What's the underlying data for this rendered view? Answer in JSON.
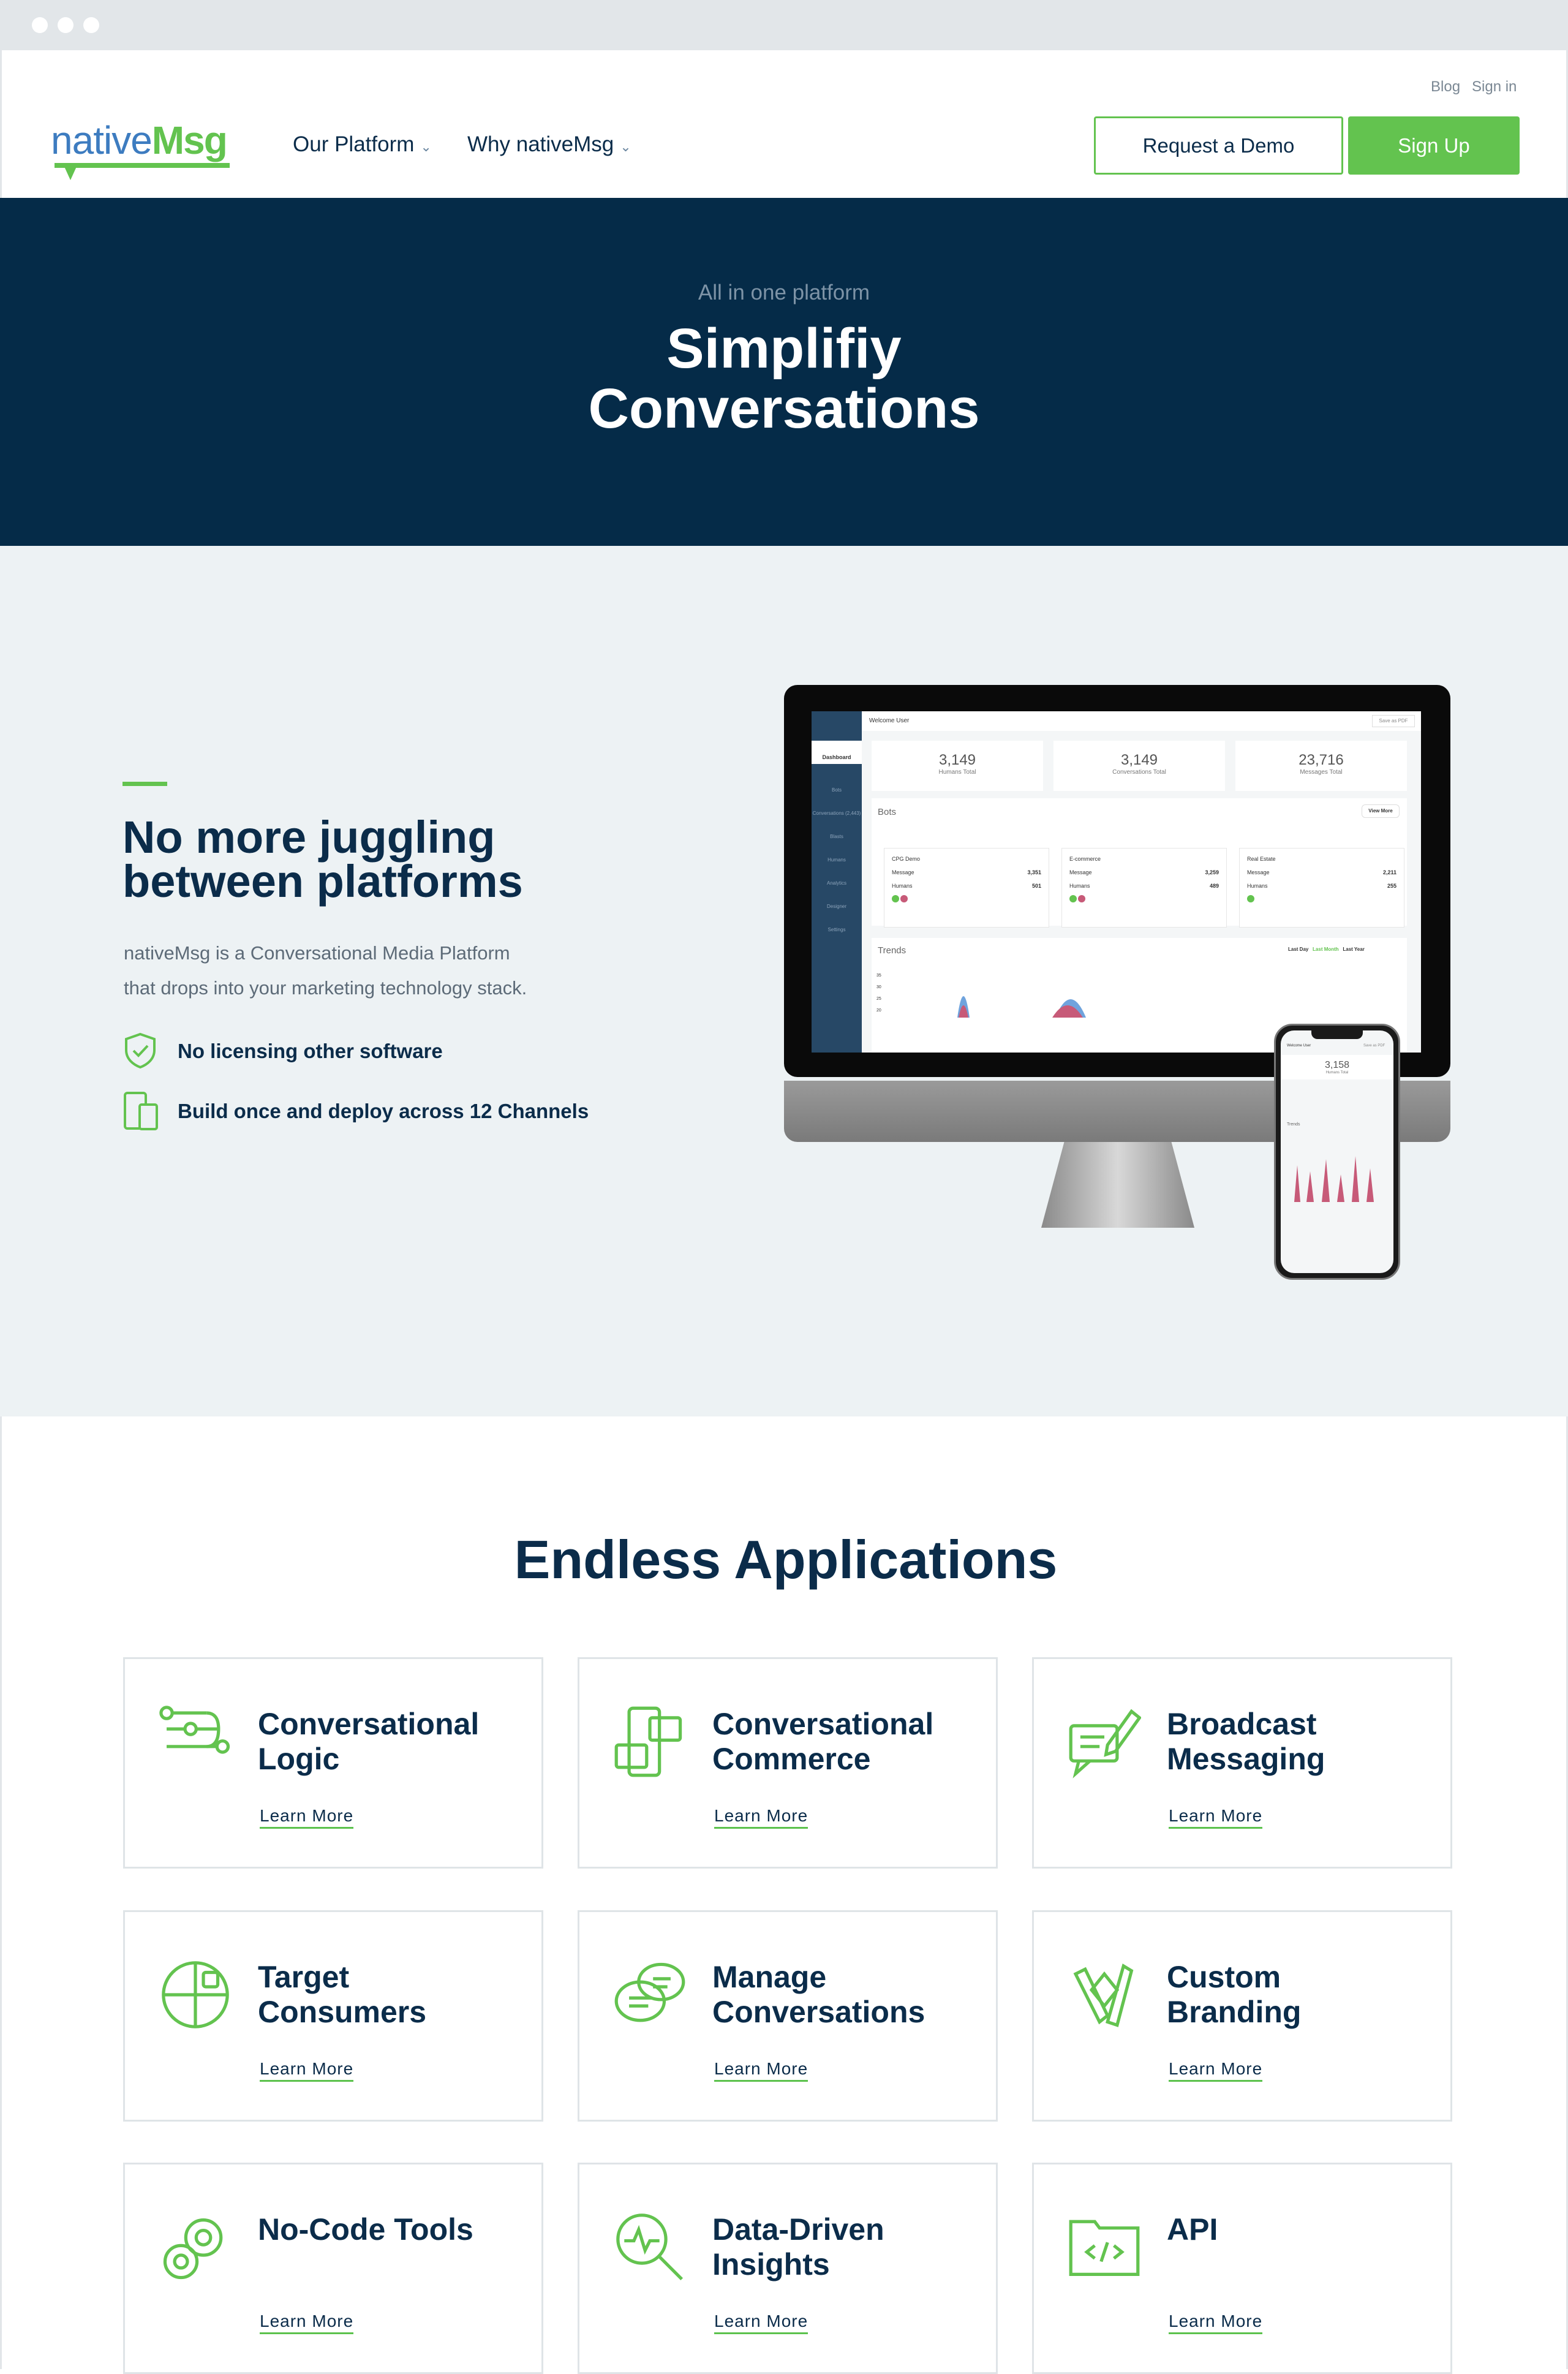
{
  "header": {
    "top_links": [
      "Blog",
      "Sign in"
    ],
    "logo": {
      "part1": "native",
      "part2": "Msg"
    },
    "nav": [
      {
        "label": "Our Platform"
      },
      {
        "label": "Why nativeMsg"
      }
    ],
    "request_demo": "Request a Demo",
    "sign_up": "Sign Up"
  },
  "hero": {
    "eyebrow": "All in one platform",
    "title_line1": "Simplifiy",
    "title_line2": "Conversations"
  },
  "intro": {
    "heading_line1": "No more juggling",
    "heading_line2": "between platforms",
    "paragraph_line1": "nativeMsg is a Conversational Media Platform",
    "paragraph_line2": "that drops into your marketing technology stack.",
    "features": [
      {
        "icon": "shield-check-icon",
        "label": "No licensing other software"
      },
      {
        "icon": "devices-icon",
        "label": "Build once and deploy across 12 Channels"
      }
    ]
  },
  "dashboard": {
    "welcome": "Welcome User",
    "save_pdf": "Save as PDF",
    "sidebar": [
      "Dashboard",
      "Bots",
      "Conversations (2,443)",
      "Blasts",
      "Humans",
      "Analytics",
      "Designer",
      "Settings"
    ],
    "stats": [
      {
        "value": "3,149",
        "label": "Humans Total"
      },
      {
        "value": "3,149",
        "label": "Conversations Total"
      },
      {
        "value": "23,716",
        "label": "Messages Total"
      }
    ],
    "bots_title": "Bots",
    "view_more": "View More",
    "bots": [
      {
        "name": "CPG Demo",
        "message": "3,351",
        "humans": "501"
      },
      {
        "name": "E-commerce",
        "message": "3,259",
        "humans": "489"
      },
      {
        "name": "Real Estate",
        "message": "2,211",
        "humans": "255"
      }
    ],
    "row_labels": {
      "message": "Message",
      "humans": "Humans"
    },
    "trends": "Trends",
    "ranges": [
      "Last Day",
      "Last Month",
      "Last Year"
    ],
    "y_ticks": [
      "35",
      "30",
      "25",
      "20"
    ],
    "phone": {
      "welcome": "Welcome User",
      "save_pdf": "Save as PDF",
      "value": "3,158",
      "label": "Humans Total",
      "trends": "Trends"
    }
  },
  "applications": {
    "title": "Endless Applications",
    "learn_more": "Learn More",
    "cards": [
      {
        "title": "Conversational Logic",
        "icon": "logic-flow-icon"
      },
      {
        "title": "Conversational Commerce",
        "icon": "phone-chat-icon"
      },
      {
        "title": "Broadcast Messaging",
        "icon": "broadcast-pen-icon"
      },
      {
        "title": "Target Consumers",
        "icon": "target-pie-icon"
      },
      {
        "title": "Manage Conversations",
        "icon": "chat-bubbles-icon"
      },
      {
        "title": "Custom Branding",
        "icon": "design-tools-icon"
      },
      {
        "title": "No-Code Tools",
        "icon": "gears-icon"
      },
      {
        "title": "Data-Driven Insights",
        "icon": "magnifier-chart-icon"
      },
      {
        "title": "API",
        "icon": "code-folder-icon"
      }
    ]
  },
  "colors": {
    "navy": "#052b48",
    "green": "#63c34f",
    "light_bg": "#edf2f4"
  }
}
